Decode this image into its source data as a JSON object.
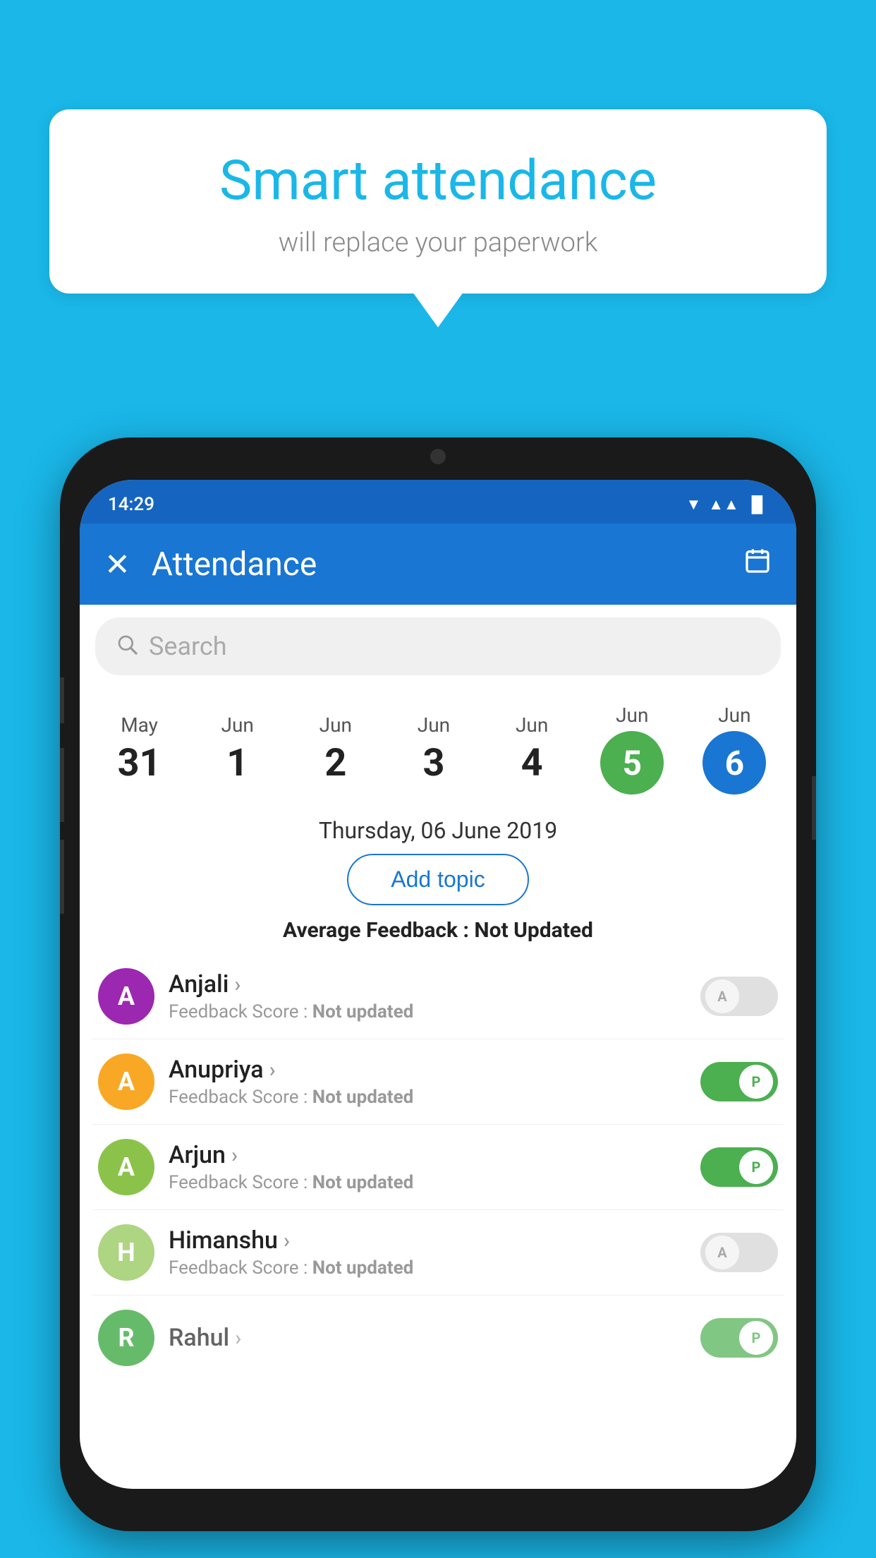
{
  "background_color": "#1ab7e8",
  "bubble": {
    "title": "Smart attendance",
    "subtitle": "will replace your paperwork"
  },
  "status_bar": {
    "time": "14:29",
    "wifi": "▼",
    "signal": "▲",
    "battery": "▌"
  },
  "app_bar": {
    "close_label": "✕",
    "title": "Attendance",
    "calendar_icon": "📅"
  },
  "search": {
    "placeholder": "Search"
  },
  "dates": [
    {
      "month": "May",
      "day": "31",
      "active": false
    },
    {
      "month": "Jun",
      "day": "1",
      "active": false
    },
    {
      "month": "Jun",
      "day": "2",
      "active": false
    },
    {
      "month": "Jun",
      "day": "3",
      "active": false
    },
    {
      "month": "Jun",
      "day": "4",
      "active": false
    },
    {
      "month": "Jun",
      "day": "5",
      "active": "green"
    },
    {
      "month": "Jun",
      "day": "6",
      "active": "blue"
    }
  ],
  "selected_date": "Thursday, 06 June 2019",
  "add_topic_label": "Add topic",
  "avg_feedback_label": "Average Feedback : ",
  "avg_feedback_value": "Not Updated",
  "students": [
    {
      "name": "Anjali",
      "initial": "A",
      "avatar_color": "#9c27b0",
      "feedback_label": "Feedback Score : ",
      "feedback_value": "Not updated",
      "toggle": "off",
      "toggle_letter": "A"
    },
    {
      "name": "Anupriya",
      "initial": "A",
      "avatar_color": "#f9a825",
      "feedback_label": "Feedback Score : ",
      "feedback_value": "Not updated",
      "toggle": "on",
      "toggle_letter": "P"
    },
    {
      "name": "Arjun",
      "initial": "A",
      "avatar_color": "#8bc34a",
      "feedback_label": "Feedback Score : ",
      "feedback_value": "Not updated",
      "toggle": "on",
      "toggle_letter": "P"
    },
    {
      "name": "Himanshu",
      "initial": "H",
      "avatar_color": "#aed581",
      "feedback_label": "Feedback Score : ",
      "feedback_value": "Not updated",
      "toggle": "off",
      "toggle_letter": "A"
    }
  ]
}
